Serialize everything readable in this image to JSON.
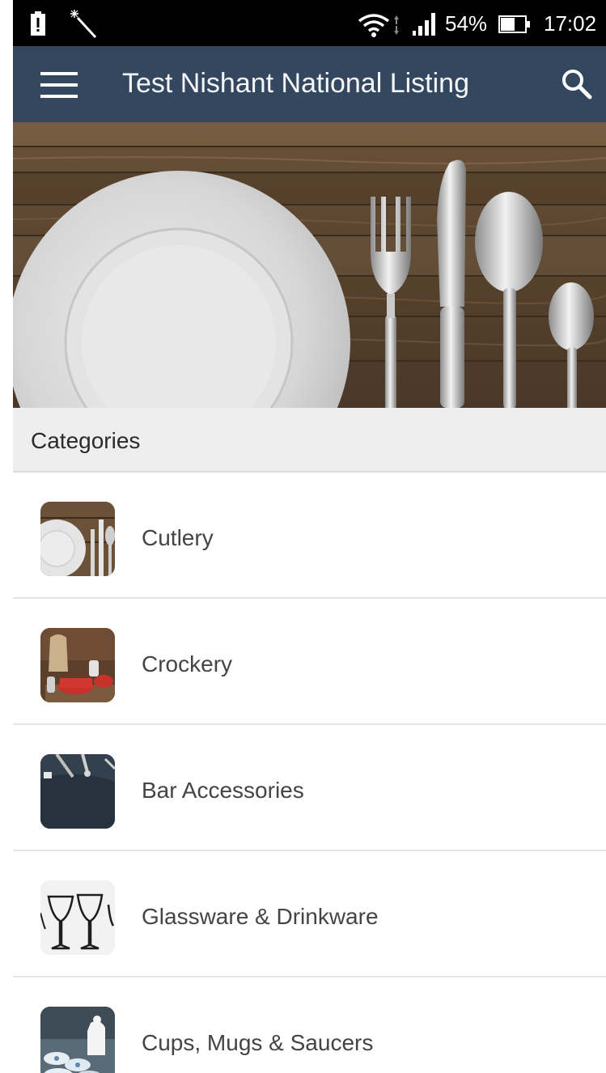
{
  "status_bar": {
    "battery_percent": "54%",
    "time": "17:02",
    "icons": [
      "battery-alert-icon",
      "magic-wand-icon",
      "wifi-icon",
      "data-arrows-icon",
      "signal-icon",
      "battery-icon"
    ]
  },
  "app_bar": {
    "title": "Test Nishant National Listing",
    "menu_icon": "menu-icon",
    "search_icon": "search-icon",
    "background": "#33475f"
  },
  "hero": {
    "image": "plate-and-cutlery-on-wooden-table"
  },
  "categories": {
    "title": "Categories",
    "items": [
      {
        "label": "Cutlery",
        "thumbnail": "cutlery-thumbnail"
      },
      {
        "label": "Crockery",
        "thumbnail": "crockery-thumbnail"
      },
      {
        "label": "Bar Accessories",
        "thumbnail": "bar-accessories-thumbnail"
      },
      {
        "label": "Glassware & Drinkware",
        "thumbnail": "glassware-thumbnail"
      },
      {
        "label": "Cups, Mugs & Saucers",
        "thumbnail": "cups-mugs-thumbnail"
      }
    ]
  }
}
